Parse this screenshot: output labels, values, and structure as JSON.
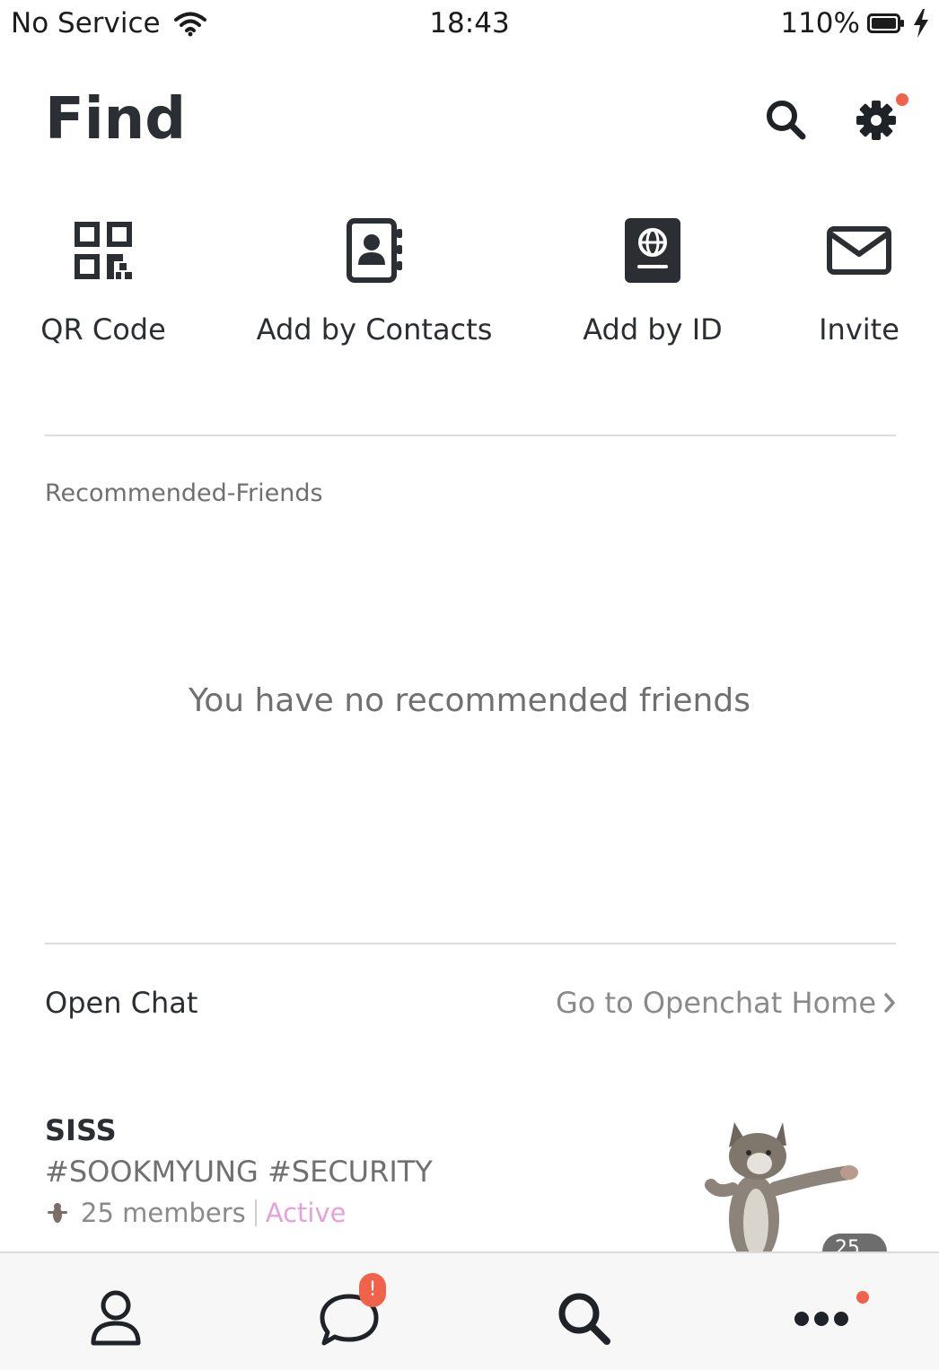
{
  "status_bar": {
    "carrier": "No Service",
    "time": "18:43",
    "battery": "110%"
  },
  "header": {
    "title": "Find",
    "search_icon": "search-icon",
    "settings_icon": "gear-icon"
  },
  "actions": [
    {
      "label": "QR Code",
      "icon": "qr-code-icon"
    },
    {
      "label": "Add by Contacts",
      "icon": "address-book-icon"
    },
    {
      "label": "Add by ID",
      "icon": "passport-icon"
    },
    {
      "label": "Invite",
      "icon": "envelope-icon"
    }
  ],
  "recommended": {
    "section_label": "Recommended-Friends",
    "empty_message": "You have no recommended friends"
  },
  "open_chat": {
    "title": "Open Chat",
    "home_link": "Go to Openchat Home",
    "item": {
      "name": "SISS",
      "tags": "#SOOKMYUNG #SECURITY",
      "members": "25 members",
      "status": "Active",
      "like_count": "25"
    }
  },
  "bottom_nav": {
    "items": [
      "profile-icon",
      "chat-bubble-icon",
      "search-icon",
      "more-dots-icon"
    ],
    "chat_badge": "!"
  },
  "colors": {
    "accent_dot": "#f0624a",
    "active_status": "#e7a1d8",
    "text_dark": "#2b2e33",
    "text_muted": "#707070"
  }
}
